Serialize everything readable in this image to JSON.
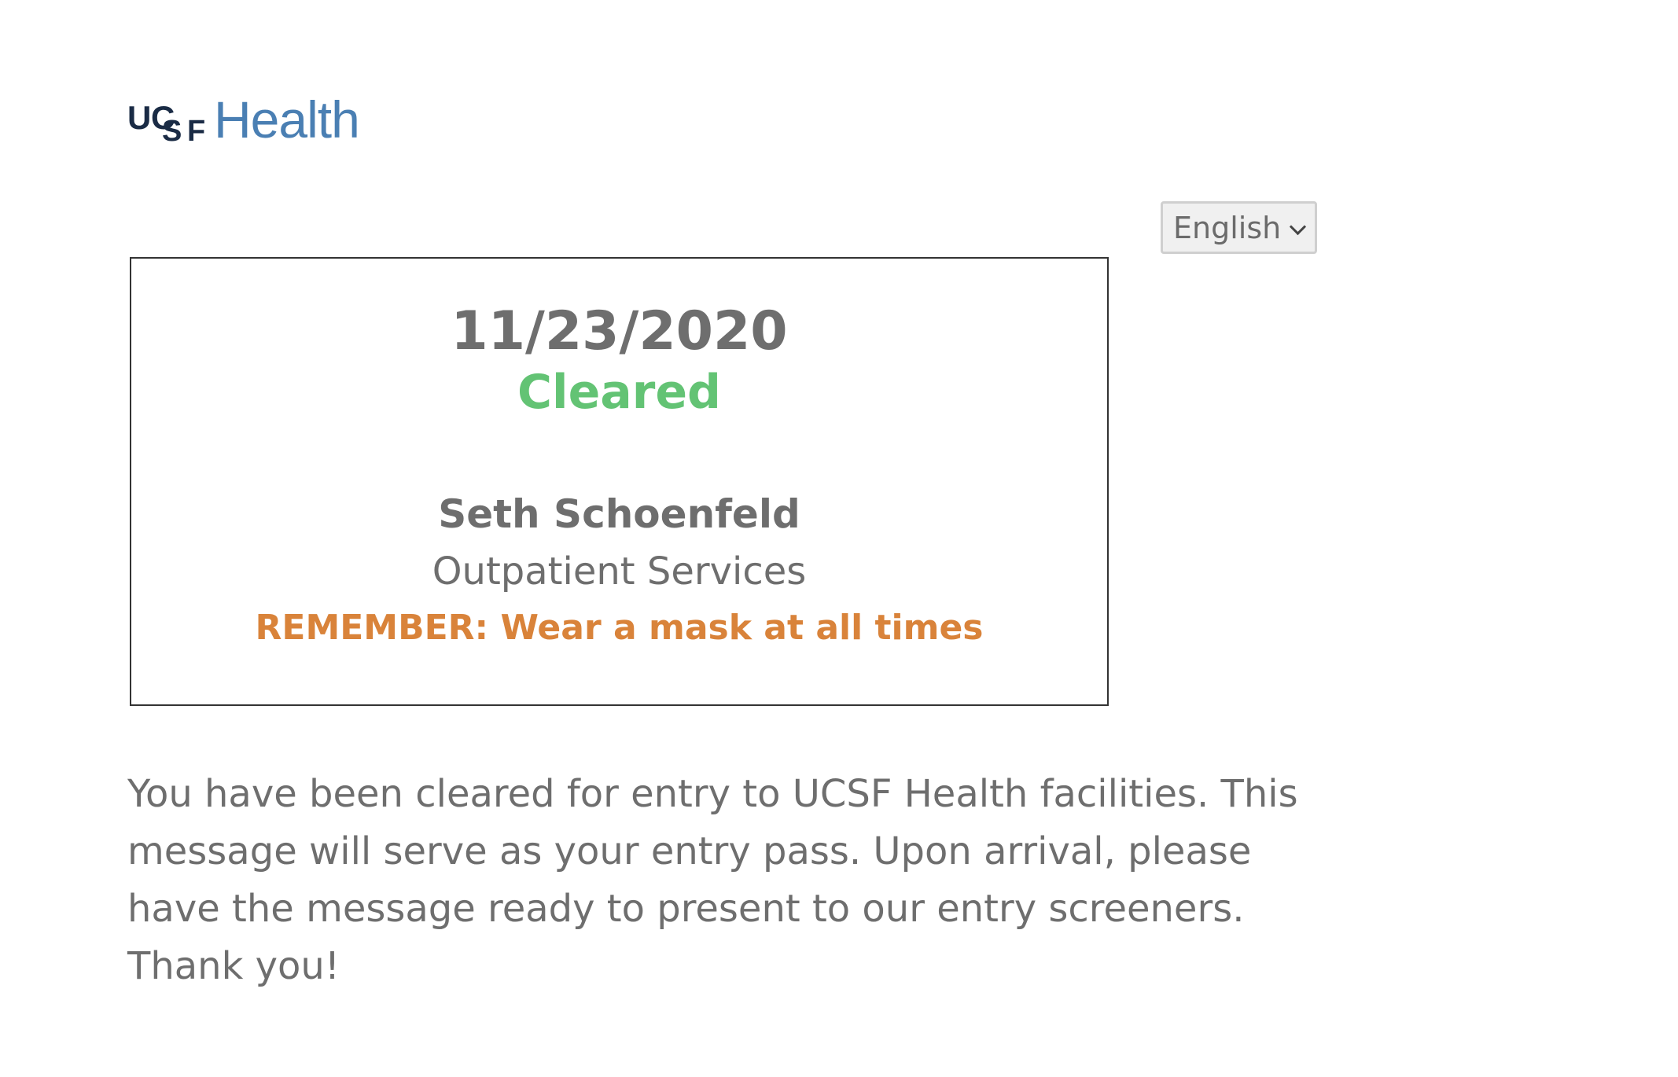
{
  "logo": {
    "ucsf_u": "U",
    "ucsf_c": "C",
    "ucsf_s": "S",
    "ucsf_f": "F",
    "health": "Health",
    "colors": {
      "ucsf": "#1a2b45",
      "health": "#4a7fb3"
    }
  },
  "language_select": {
    "selected": "English"
  },
  "card": {
    "date": "11/23/2020",
    "status": "Cleared",
    "name": "Seth Schoenfeld",
    "department": "Outpatient Services",
    "reminder": "REMEMBER: Wear a mask at all times",
    "colors": {
      "status": "#63c374",
      "reminder": "#d9833a",
      "text": "#6e6e6e"
    }
  },
  "message": "You have been cleared for entry to UCSF Health facilities. This message will serve as your entry pass. Upon arrival, please have the message ready to present to our entry screeners. Thank you!"
}
